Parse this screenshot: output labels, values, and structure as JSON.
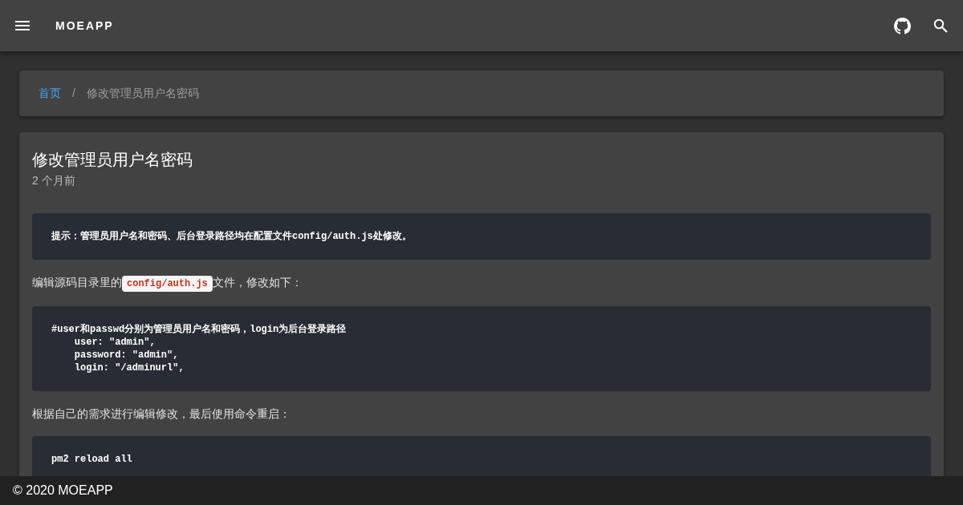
{
  "app_bar": {
    "title": "MOEAPP"
  },
  "breadcrumb": [
    {
      "label": "首页",
      "kind": "link"
    },
    {
      "label": "/",
      "kind": "separator"
    },
    {
      "label": "修改管理员用户名密码",
      "kind": "current"
    }
  ],
  "article": {
    "title": "修改管理员用户名密码",
    "date": "2 个月前",
    "blocks": [
      {
        "kind": "code",
        "lines": [
          "提示：管理员用户名和密码、后台登录路径均在配置文件config/auth.js处修改。"
        ]
      },
      {
        "kind": "paragraph",
        "before": "编辑源码目录里的",
        "code": "config/auth.js",
        "after": "文件，修改如下："
      },
      {
        "kind": "code",
        "lines": [
          "#user和passwd分别为管理员用户名和密码，login为后台登录路径",
          "    user: \"admin\",",
          "    password: \"admin\",",
          "    login: \"/adminurl\","
        ]
      },
      {
        "kind": "paragraph",
        "before": "根据自己的需求进行编辑修改，最后使用命令重启："
      },
      {
        "kind": "code",
        "lines": [
          "pm2 reload all"
        ]
      }
    ]
  },
  "footer": {
    "text": "© 2020 MOEAPP"
  }
}
